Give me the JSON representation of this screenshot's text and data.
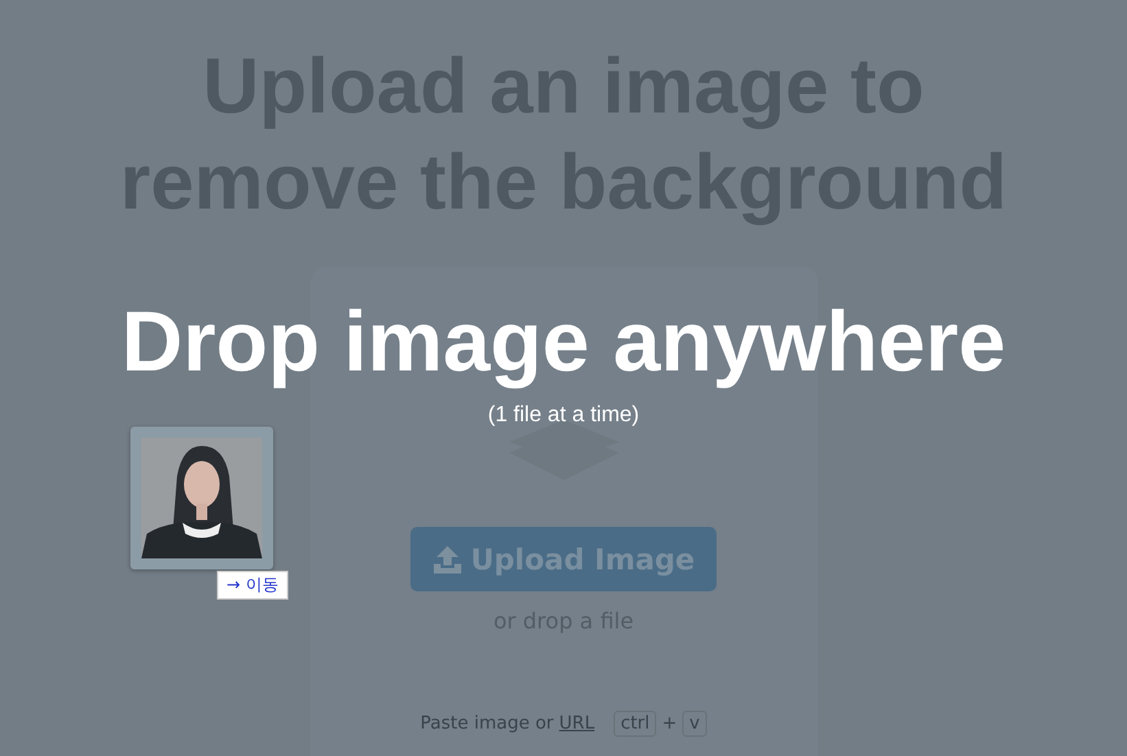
{
  "headline": [
    "Upload an image to",
    "remove the background"
  ],
  "overlay": {
    "title": "Drop image anywhere",
    "subtitle": "(1 file at a time)"
  },
  "upload_button": "Upload Image",
  "drop_hint": "or drop a file",
  "paste_hint": {
    "text": "Paste image or",
    "link": "URL",
    "keys": [
      "ctrl",
      "v"
    ],
    "joiner": "+"
  },
  "drag_preview": {
    "kind": "picture",
    "tooltip": "→ 이동"
  }
}
